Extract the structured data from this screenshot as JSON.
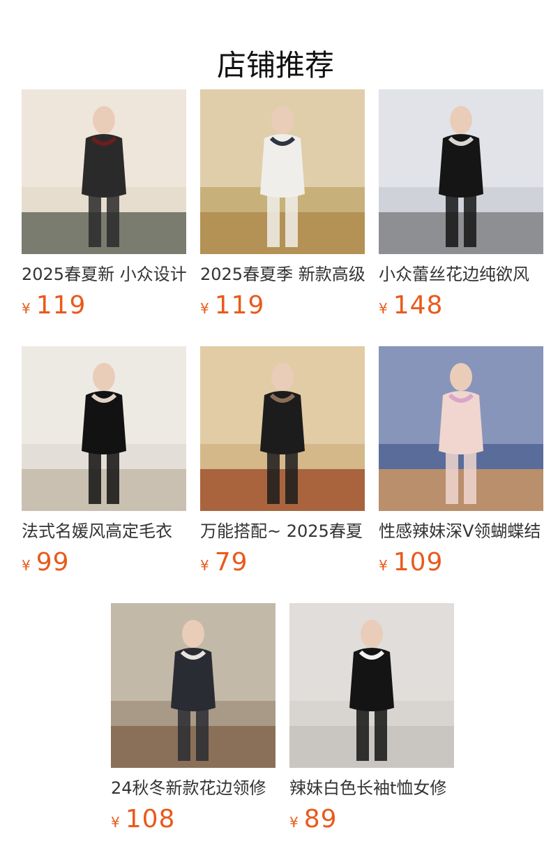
{
  "section": {
    "title": "店铺推荐"
  },
  "currency_symbol": "¥",
  "products": [
    {
      "name": "2025春夏新 小众设计",
      "price": "119",
      "image": {
        "bg": "#e6ddcf",
        "top": "#f2eadf",
        "floor": "#7b7c70",
        "figure": "#2a2a2a",
        "accent": "#6b1d1f"
      }
    },
    {
      "name": "2025春夏季 新款高级",
      "price": "119",
      "image": {
        "bg": "#c8b07a",
        "top": "#e9dcc0",
        "floor": "#b49154",
        "figure": "#f0eeea",
        "accent": "#2d3442"
      }
    },
    {
      "name": "小众蕾丝花边纯欲风",
      "price": "148",
      "image": {
        "bg": "#cfd3d9",
        "top": "#e8eaee",
        "floor": "#8e8f92",
        "figure": "#151515",
        "accent": "#d9d6d3"
      }
    },
    {
      "name": "法式名媛风高定毛衣",
      "price": "99",
      "image": {
        "bg": "#e3dfd8",
        "top": "#f1eeea",
        "floor": "#c9c0b1",
        "figure": "#121212",
        "accent": "#e2d3c6"
      }
    },
    {
      "name": "万能搭配~ 2025春夏",
      "price": "79",
      "image": {
        "bg": "#d4b88a",
        "top": "#e7d4b2",
        "floor": "#a9643e",
        "figure": "#1c1c1c",
        "accent": "#8c6e58"
      }
    },
    {
      "name": "性感辣妹深V领蝴蝶结",
      "price": "109",
      "image": {
        "bg": "#5a6d9a",
        "top": "#9ba6c7",
        "floor": "#b98f6c",
        "figure": "#f0d6cf",
        "accent": "#d9a6c8"
      }
    },
    {
      "name": "24秋冬新款花边领修",
      "price": "108",
      "image": {
        "bg": "#a89a86",
        "top": "#cfc6b8",
        "floor": "#8a7058",
        "figure": "#2a2c33",
        "accent": "#e8e4df"
      }
    },
    {
      "name": "辣妹白色长袖t恤女修",
      "price": "89",
      "image": {
        "bg": "#d8d4d0",
        "top": "#e4e1de",
        "floor": "#c9c5c1",
        "figure": "#141414",
        "accent": "#f3f3f3"
      }
    }
  ]
}
